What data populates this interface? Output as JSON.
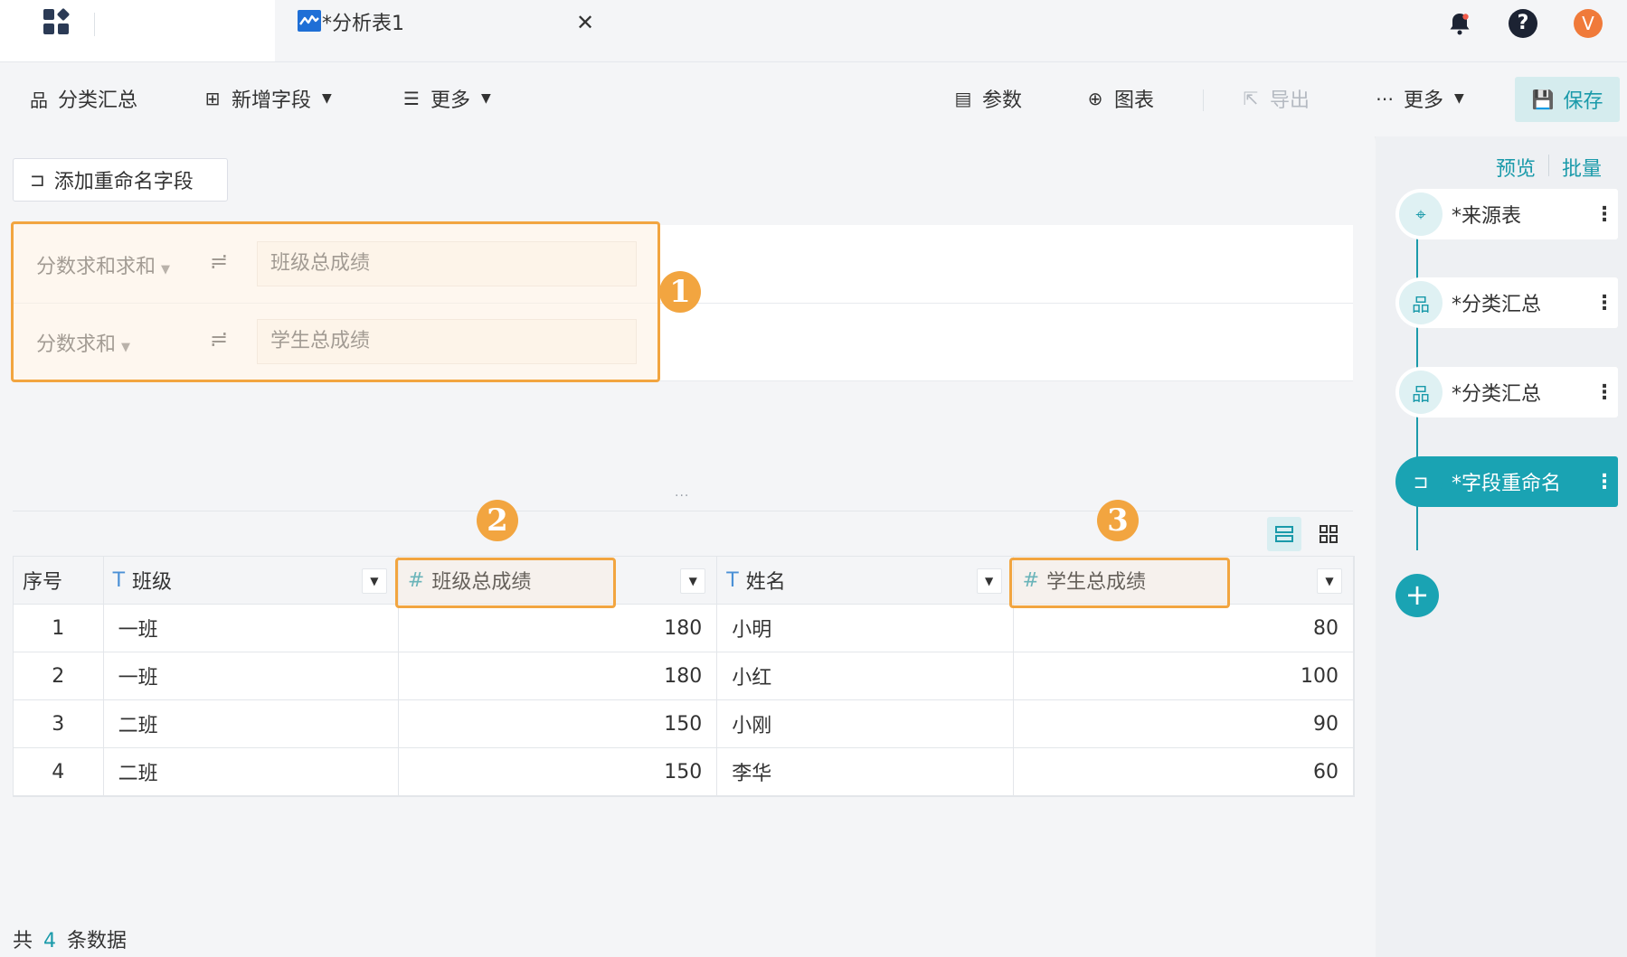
{
  "header": {
    "tab_title": "*分析表1",
    "tab_close": "✕",
    "avatar_letter": "V",
    "help_glyph": "?"
  },
  "toolbar": {
    "group_summary": "分类汇总",
    "add_field": "新增字段",
    "more_left": "更多",
    "params": "参数",
    "chart": "图表",
    "export": "导出",
    "more_right": "更多",
    "save": "保存"
  },
  "rename": {
    "add_button": "添加重命名字段",
    "rows": [
      {
        "source": "分数求和求和",
        "target": "班级总成绩"
      },
      {
        "source": "分数求和",
        "target": "学生总成绩"
      }
    ],
    "arrow_glyph": "≓"
  },
  "annotations": {
    "badge1": "1",
    "badge2": "2",
    "badge3": "3",
    "highlight_color": "#f2a540"
  },
  "splitter": "···",
  "table": {
    "columns": [
      {
        "label": "序号",
        "type": ""
      },
      {
        "label": "班级",
        "type": "T"
      },
      {
        "label": "班级总成绩",
        "type": "#"
      },
      {
        "label": "姓名",
        "type": "T"
      },
      {
        "label": "学生总成绩",
        "type": "#"
      }
    ],
    "rows": [
      [
        "1",
        "一班",
        "180",
        "小明",
        "80"
      ],
      [
        "2",
        "一班",
        "180",
        "小红",
        "100"
      ],
      [
        "3",
        "二班",
        "150",
        "小刚",
        "90"
      ],
      [
        "4",
        "二班",
        "150",
        "李华",
        "60"
      ]
    ],
    "footer": {
      "prefix": "共",
      "count": "4",
      "suffix": "条数据"
    }
  },
  "steps": {
    "preview": "预览",
    "batch": "批量",
    "items": [
      {
        "label": "*来源表",
        "icon": "source-icon"
      },
      {
        "label": "*分类汇总",
        "icon": "group-summary-icon"
      },
      {
        "label": "*分类汇总",
        "icon": "group-summary-icon"
      },
      {
        "label": "*字段重命名",
        "icon": "rename-icon"
      }
    ],
    "add_glyph": "+"
  },
  "colors": {
    "accent": "#1aa3b3",
    "tab_icon": "#1f6fd6",
    "avatar": "#f07a3a",
    "bell": "#1c2333"
  }
}
